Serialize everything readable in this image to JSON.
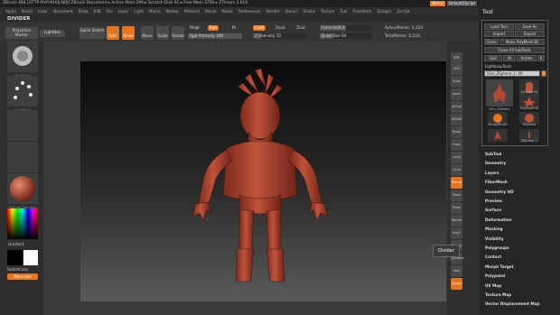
{
  "titlebar": {
    "text": "ZBrush 4R4 [OTTP-PHIY-KHUJ-NRJ] ZBrush Document ▸ Active Mem 299 ▸ Scratch Disk 91 ▸ Free Mem 3794 ▸ ZTimers 2.619",
    "btn_menus": "Menus",
    "btn_script": "DefaultZScript"
  },
  "menubar": [
    "Alpha",
    "Brush",
    "Color",
    "Document",
    "Draw",
    "Edit",
    "File",
    "Layer",
    "Light",
    "Macro",
    "Marker",
    "Material",
    "Movie",
    "Picker",
    "Preferences",
    "Render",
    "Stencil",
    "Stroke",
    "Texture",
    "Tool",
    "Transform",
    "Zplugin",
    "Zscript"
  ],
  "document": {
    "name": "DIVIDER"
  },
  "topshelf": {
    "projection_master": "Projection Master",
    "lightbox": "LightBox",
    "quick_sketch": "Quick Sketch",
    "edit": "Edit",
    "draw": "Draw",
    "move": "Move",
    "scale": "Scale",
    "rotate": "Rotate",
    "mrgb": "Mrgb",
    "rgb": "Rgb",
    "m": "M",
    "zadd": "Zadd",
    "zsub": "Zsub",
    "zcut": "Zcut",
    "rgb_intensity": "Rgb Intensity 100",
    "z_intensity": "Z Intensity 15",
    "focal_shift": "Focal Shift 0",
    "draw_size": "Draw Size 64",
    "active_points": "ActivePoints: 5,224",
    "total_points": "TotalPoints: 5,224"
  },
  "progress": {
    "rgb_intensity": 1.0,
    "z_intensity": 0.15,
    "focal_shift": 0.5,
    "draw_size": 0.25
  },
  "leftshelf": {
    "thumb1": "Standard",
    "thumb2": "DragRect",
    "thumb3": "Alpha Off",
    "thumb4": "Texture Off",
    "thumb5": "MatCap Red Wax",
    "gradient": "Gradient",
    "switch_color": "SwitchColor",
    "alternate": "Alternate"
  },
  "rightshelf": [
    "BPR",
    "SPix",
    "Scroll",
    "Zoom",
    "Actual",
    "AAHalf",
    "Persp",
    "Floor",
    "Local",
    "LSym",
    "Frame",
    "Move",
    "Scale",
    "Rotate",
    "PolyF",
    "Transp",
    "Dynamic",
    "Solo",
    "Xpose"
  ],
  "rightshelf_orange": [
    "Frame",
    "Xpose"
  ],
  "tooltip": "Divider",
  "tray": {
    "title": "Tool",
    "buttons": [
      "Load Tool",
      "Save As",
      "Import",
      "Export",
      "Clone",
      "Make PolyMesh3D",
      "Clone All SubTools",
      "GoZ",
      "All",
      "Visible",
      "R"
    ],
    "lightbox_tools": "Lightbox▸Tools",
    "current_tool": "Skin_ZSphere_1. 49",
    "tools": [
      "Skin_ZSphere",
      "Cylinder3D",
      "PolyMesh3D",
      "SimpleBrush",
      "ZSphere",
      "ZSphere_1"
    ],
    "menu": [
      "SubTool",
      "Geometry",
      "Layers",
      "FiberMesh",
      "Geometry HD",
      "Preview",
      "Surface",
      "Deformation",
      "Masking",
      "Visibility",
      "Polygroups",
      "Contact",
      "Morph Target",
      "Polypaint",
      "UV Map",
      "Texture Map",
      "Vector Displacement Map"
    ]
  },
  "colors": {
    "accent": "#e8741c",
    "model": "#a8402e",
    "bg": "#2a2a2a"
  }
}
